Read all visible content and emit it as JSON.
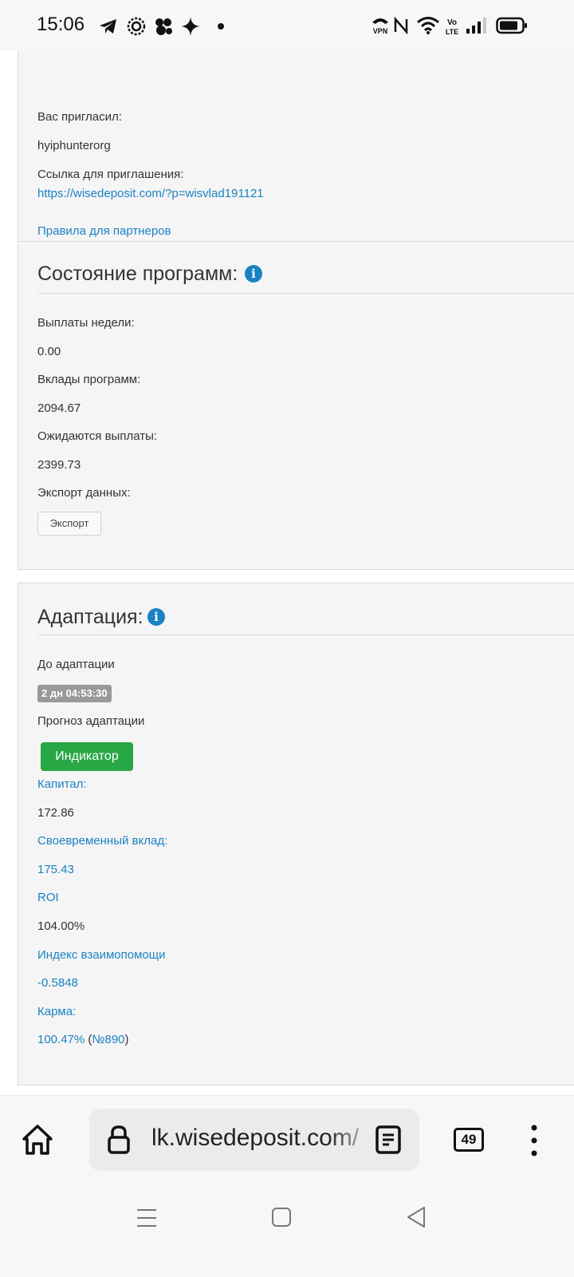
{
  "status_bar": {
    "time": "15:06",
    "vpn_label": "VPN",
    "volte_label": "Vo LTE"
  },
  "referral": {
    "invited_by_label": "Вас пригласил:",
    "invited_by_value": "hyiphunterorg",
    "invite_link_label": "Ссылка для приглашения:",
    "invite_link": "https://wisedeposit.com/?p=wisvlad191121",
    "partner_rules": "Правила для партнеров"
  },
  "programs": {
    "title": "Состояние программ:",
    "weekly_payouts_label": "Выплаты недели:",
    "weekly_payouts_value": "0.00",
    "deposits_label": "Вклады программ:",
    "deposits_value": "2094.67",
    "expected_label": "Ожидаются выплаты:",
    "expected_value": "2399.73",
    "export_label": "Экспорт данных:",
    "export_button": "Экспорт"
  },
  "adaptation": {
    "title": "Адаптация:",
    "until_label": "До адаптации",
    "countdown": "2 дн 04:53:30",
    "forecast_label": "Прогноз адаптации",
    "indicator_button": "Индикатор",
    "capital_label": "Капитал:",
    "capital_value": "172.86",
    "timely_label": "Своевременный вклад:",
    "timely_value": "175.43",
    "roi_label": "ROI",
    "roi_value": "104.00%",
    "mutual_label": "Индекс взаимопомощи",
    "mutual_value": "-0.5848",
    "karma_label": "Карма:",
    "karma_value": "100.47%",
    "karma_open": " (",
    "karma_rank": "№890",
    "karma_close": ")"
  },
  "browser": {
    "url": "lk.wisedeposit.com/",
    "tab_count": "49"
  },
  "colors": {
    "link": "#1a82c3",
    "success": "#28a745",
    "badge": "#999999",
    "panel": "#f5f5f5"
  }
}
